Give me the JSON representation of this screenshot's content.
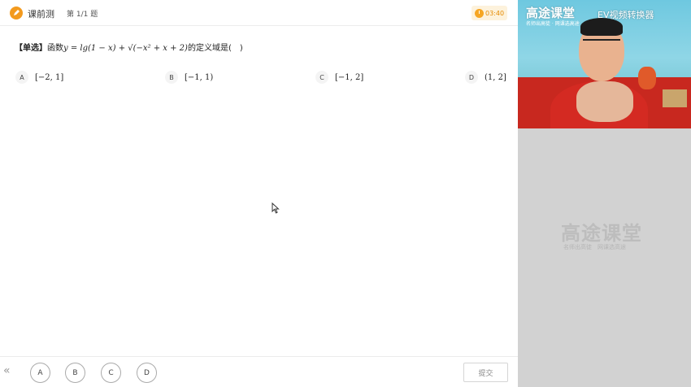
{
  "header": {
    "quiz_title": "课前测",
    "progress": "第 1/1 题",
    "timer": "03:40"
  },
  "question": {
    "type_label": "【单选】",
    "stem_prefix": "函数",
    "formula": "y = lg(1 − x) + √(−x² + x + 2)",
    "stem_suffix": "的定义域是(　)"
  },
  "options": [
    {
      "letter": "A",
      "value": "[−2, 1]"
    },
    {
      "letter": "B",
      "value": "[−1, 1)"
    },
    {
      "letter": "C",
      "value": "[−1, 2]"
    },
    {
      "letter": "D",
      "value": "(1, 2]"
    }
  ],
  "answer_bar": {
    "collapse_icon": "«",
    "choices": [
      "A",
      "B",
      "C",
      "D"
    ],
    "submit_label": "提交"
  },
  "video": {
    "brand": "高途课堂",
    "brand_sub": "名师出高徒 · 网课选高途",
    "watermark": "EV视频转换器"
  },
  "logo": {
    "title": "高途课堂",
    "subtitle": "名师出高徒　网课选高途"
  },
  "colors": {
    "accent_orange": "#f39a1e",
    "timer_text": "#e58a00",
    "right_panel_bg": "#d2d2d2"
  }
}
